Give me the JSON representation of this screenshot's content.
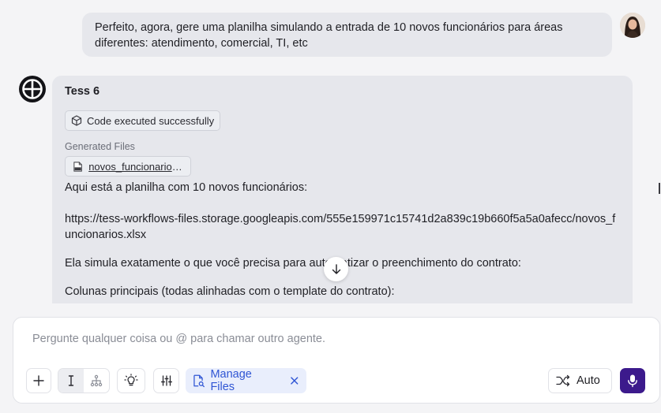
{
  "user_message": {
    "text": "Perfeito, agora, gere uma planilha simulando a entrada de 10 novos funcionários para áreas diferentes: atendimento, comercial, TI, etc",
    "avatar_icon": "user-avatar-photo"
  },
  "assistant": {
    "name": "Tess 6",
    "logo_icon": "tess-logo",
    "exec_badge": {
      "icon": "cube-icon",
      "label": "Code executed successfully"
    },
    "generated_files_label": "Generated Files",
    "file": {
      "icon": "xls-file-icon",
      "name": "novos_funcionarios.xlsx"
    },
    "paragraphs": [
      "Aqui está a planilha com 10 novos funcionários:",
      "https://tess-workflows-files.storage.googleapis.com/555e159971c15741d2a839c19b660f5a5a0afecc/novos_funcionarios.xlsx",
      "Ela simula exatamente o que você precisa para automatizar o preenchimento do contrato:",
      "Colunas principais (todas alinhadas com o template do contrato):"
    ]
  },
  "composer": {
    "placeholder": "Pergunte qualquer coisa ou @ para chamar outro agente.",
    "value": "",
    "manage_files_label": "Manage Files",
    "auto_label": "Auto",
    "accent_color": "#2f55d4",
    "mic_color": "#3c1a8c"
  }
}
